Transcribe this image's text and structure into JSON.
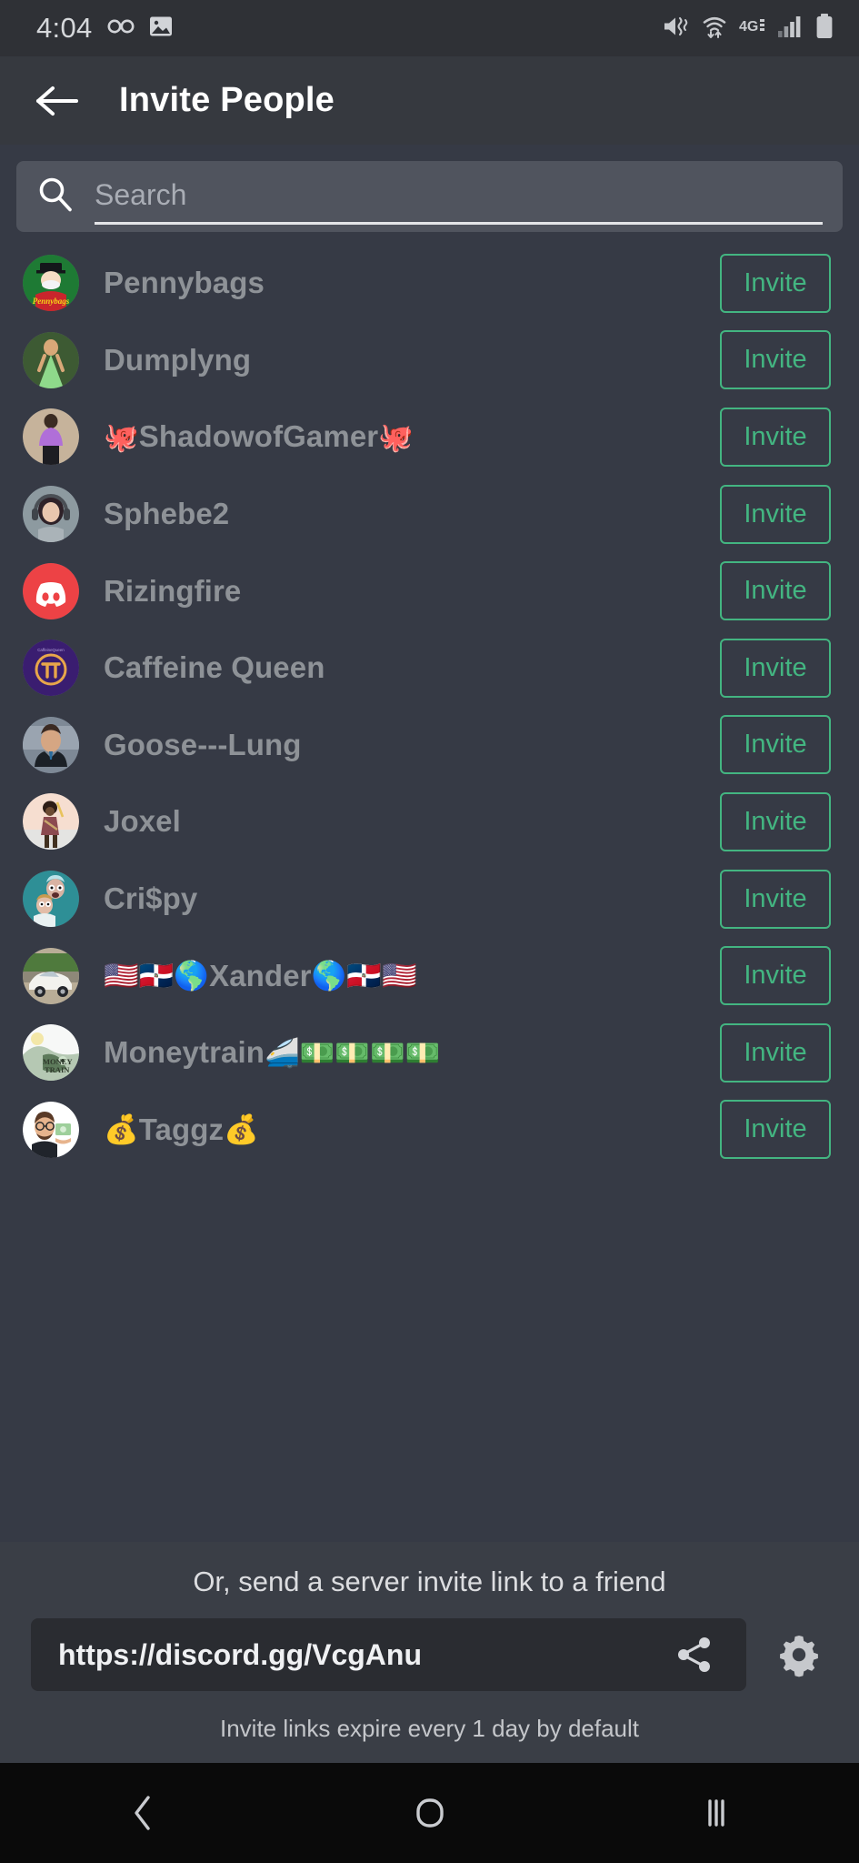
{
  "status_bar": {
    "time": "4:04",
    "left_icons": [
      "voicemail-icon",
      "image-icon"
    ],
    "right_icons": [
      "vibrate-mute-icon",
      "wifi-transfer-icon",
      "network-4g-icon",
      "signal-bars-icon",
      "battery-icon"
    ],
    "network_label": "4G"
  },
  "appbar": {
    "back_icon": "back-arrow-icon",
    "title": "Invite People"
  },
  "search": {
    "icon": "search-icon",
    "placeholder": "Search",
    "value": ""
  },
  "invite_label": "Invite",
  "members": [
    {
      "name": "Pennybags",
      "prefix": "",
      "suffix": "",
      "avatar": "pennybags-monopoly-man"
    },
    {
      "name": "Dumplyng",
      "prefix": "",
      "suffix": "",
      "avatar": "person-green-dress"
    },
    {
      "name": "ShadowofGamer",
      "prefix": "🐙",
      "suffix": "🐙",
      "avatar": "person-purple-shirt"
    },
    {
      "name": "Sphebe2",
      "prefix": "",
      "suffix": "",
      "avatar": "woman-headphones"
    },
    {
      "name": "Rizingfire",
      "prefix": "",
      "suffix": "",
      "avatar": "discord-default-red"
    },
    {
      "name": "Caffeine Queen",
      "prefix": "",
      "suffix": "",
      "avatar": "purple-pi-logo"
    },
    {
      "name": "Goose---Lung",
      "prefix": "",
      "suffix": "",
      "avatar": "man-suit-portrait"
    },
    {
      "name": "Joxel",
      "prefix": "",
      "suffix": "",
      "avatar": "anime-character"
    },
    {
      "name": "Cri$py",
      "prefix": "",
      "suffix": "",
      "avatar": "rick-and-morty"
    },
    {
      "name": "Xander",
      "prefix": "🇺🇸🇩🇴🌎",
      "suffix": "🌎🇩🇴🇺🇸",
      "avatar": "white-sports-car"
    },
    {
      "name": "Moneytrain ",
      "prefix": "",
      "suffix": "🚄💵💵💵💵",
      "avatar": "money-train-logo"
    },
    {
      "name": "Taggz",
      "prefix": "💰",
      "suffix": "💰",
      "avatar": "bitmoji-man-cash"
    }
  ],
  "link_panel": {
    "caption": "Or, send a server invite link to a friend",
    "url": "https://discord.gg/VcgAnu",
    "share_icon": "share-icon",
    "settings_icon": "gear-icon",
    "note": "Invite links expire every 1 day by default"
  },
  "nav_bar": {
    "back": "nav-back-icon",
    "home": "nav-home-icon",
    "recents": "nav-recents-icon"
  },
  "colors": {
    "accent_green": "#43B581",
    "background": "#363A45",
    "appbar": "#36393F",
    "status_bar": "#2F3136",
    "search_field": "#50545E",
    "panel": "#3A3E46",
    "link_field": "#2A2C31",
    "username_text": "#8E9297"
  }
}
